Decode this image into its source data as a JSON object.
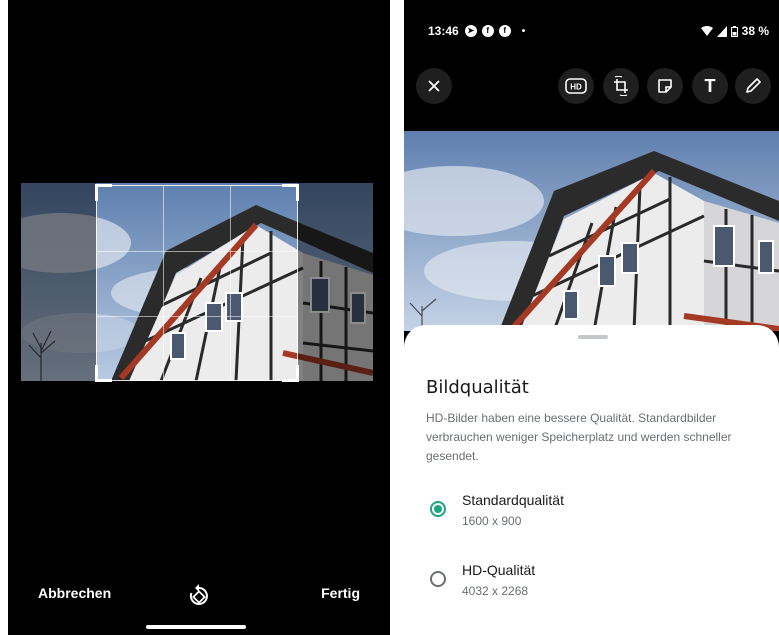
{
  "crop_screen": {
    "cancel_label": "Abbrechen",
    "done_label": "Fertig",
    "rotate_icon": "rotate-icon"
  },
  "editor": {
    "status_bar": {
      "time": "13:46",
      "battery": "38 %"
    },
    "toolbar": {
      "close_icon": "close-icon",
      "hd_label": "HD",
      "crop_rotate_icon": "crop-rotate-icon",
      "sticker_icon": "sticker-icon",
      "text_label": "T",
      "pencil_icon": "pencil-icon"
    },
    "quality_sheet": {
      "title": "Bildqualität",
      "description": "HD-Bilder haben eine bessere Qualität. Standardbilder verbrauchen weniger Speicherplatz und werden schneller gesendet.",
      "options": [
        {
          "label": "Standardqualität",
          "resolution": "1600 x 900",
          "selected": true
        },
        {
          "label": "HD-Qualität",
          "resolution": "4032 x 2268",
          "selected": false
        }
      ]
    }
  },
  "colors": {
    "accent": "#1ea584",
    "background_dark": "#000000",
    "sheet_background": "#ffffff"
  }
}
